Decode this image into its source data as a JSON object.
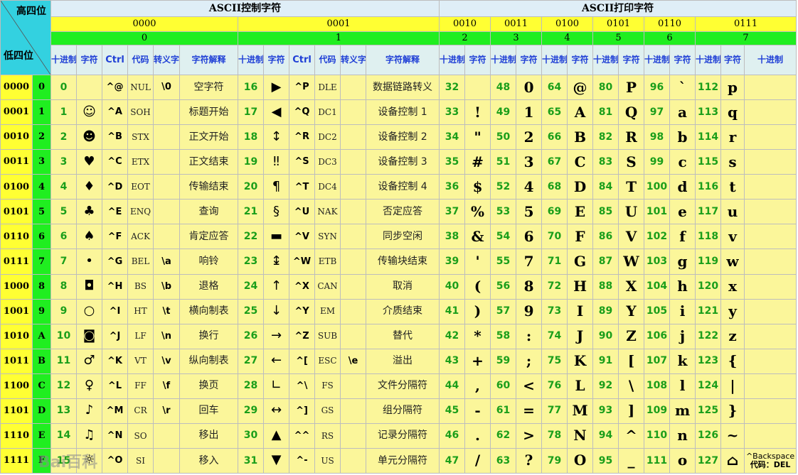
{
  "corner": {
    "high_label": "高四位",
    "low_label": "低四位"
  },
  "sections": {
    "control_title": "ASCII控制字符",
    "printable_title": "ASCII打印字符"
  },
  "high_groups": [
    {
      "bin": "0000",
      "hex": "0"
    },
    {
      "bin": "0001",
      "hex": "1"
    },
    {
      "bin": "0010",
      "hex": "2"
    },
    {
      "bin": "0011",
      "hex": "3"
    },
    {
      "bin": "0100",
      "hex": "4"
    },
    {
      "bin": "0101",
      "hex": "5"
    },
    {
      "bin": "0110",
      "hex": "6"
    },
    {
      "bin": "0111",
      "hex": "7"
    }
  ],
  "headers": {
    "decimal": "十进制",
    "char": "字符",
    "ctrl": "Ctrl",
    "code": "代码",
    "escape": "转义字符",
    "description": "字符解释"
  },
  "rows": [
    {
      "bin": "0000",
      "hex": "0",
      "g0": {
        "dec": "0",
        "char": "",
        "ctrl": "^@",
        "code": "NUL",
        "esc": "\\0",
        "desc": "空字符"
      },
      "g1": {
        "dec": "16",
        "char": "▶",
        "ctrl": "^P",
        "code": "DLE",
        "esc": "",
        "desc": "数据链路转义"
      },
      "p": [
        {
          "dec": "32",
          "char": ""
        },
        {
          "dec": "48",
          "char": "0"
        },
        {
          "dec": "64",
          "char": "@"
        },
        {
          "dec": "80",
          "char": "P"
        },
        {
          "dec": "96",
          "char": "`"
        },
        {
          "dec": "112",
          "char": "p"
        }
      ]
    },
    {
      "bin": "0001",
      "hex": "1",
      "g0": {
        "dec": "1",
        "char": "☺",
        "ctrl": "^A",
        "code": "SOH",
        "esc": "",
        "desc": "标题开始"
      },
      "g1": {
        "dec": "17",
        "char": "◀",
        "ctrl": "^Q",
        "code": "DC1",
        "esc": "",
        "desc": "设备控制 1"
      },
      "p": [
        {
          "dec": "33",
          "char": "!"
        },
        {
          "dec": "49",
          "char": "1"
        },
        {
          "dec": "65",
          "char": "A"
        },
        {
          "dec": "81",
          "char": "Q"
        },
        {
          "dec": "97",
          "char": "a"
        },
        {
          "dec": "113",
          "char": "q"
        }
      ]
    },
    {
      "bin": "0010",
      "hex": "2",
      "g0": {
        "dec": "2",
        "char": "☻",
        "ctrl": "^B",
        "code": "STX",
        "esc": "",
        "desc": "正文开始"
      },
      "g1": {
        "dec": "18",
        "char": "↕",
        "ctrl": "^R",
        "code": "DC2",
        "esc": "",
        "desc": "设备控制 2"
      },
      "p": [
        {
          "dec": "34",
          "char": "\""
        },
        {
          "dec": "50",
          "char": "2"
        },
        {
          "dec": "66",
          "char": "B"
        },
        {
          "dec": "82",
          "char": "R"
        },
        {
          "dec": "98",
          "char": "b"
        },
        {
          "dec": "114",
          "char": "r"
        }
      ]
    },
    {
      "bin": "0011",
      "hex": "3",
      "g0": {
        "dec": "3",
        "char": "♥",
        "ctrl": "^C",
        "code": "ETX",
        "esc": "",
        "desc": "正文结束"
      },
      "g1": {
        "dec": "19",
        "char": "‼",
        "ctrl": "^S",
        "code": "DC3",
        "esc": "",
        "desc": "设备控制 3"
      },
      "p": [
        {
          "dec": "35",
          "char": "#"
        },
        {
          "dec": "51",
          "char": "3"
        },
        {
          "dec": "67",
          "char": "C"
        },
        {
          "dec": "83",
          "char": "S"
        },
        {
          "dec": "99",
          "char": "c"
        },
        {
          "dec": "115",
          "char": "s"
        }
      ]
    },
    {
      "bin": "0100",
      "hex": "4",
      "g0": {
        "dec": "4",
        "char": "♦",
        "ctrl": "^D",
        "code": "EOT",
        "esc": "",
        "desc": "传输结束"
      },
      "g1": {
        "dec": "20",
        "char": "¶",
        "ctrl": "^T",
        "code": "DC4",
        "esc": "",
        "desc": "设备控制 4"
      },
      "p": [
        {
          "dec": "36",
          "char": "$"
        },
        {
          "dec": "52",
          "char": "4"
        },
        {
          "dec": "68",
          "char": "D"
        },
        {
          "dec": "84",
          "char": "T"
        },
        {
          "dec": "100",
          "char": "d"
        },
        {
          "dec": "116",
          "char": "t"
        }
      ]
    },
    {
      "bin": "0101",
      "hex": "5",
      "g0": {
        "dec": "5",
        "char": "♣",
        "ctrl": "^E",
        "code": "ENQ",
        "esc": "",
        "desc": "查询"
      },
      "g1": {
        "dec": "21",
        "char": "§",
        "ctrl": "^U",
        "code": "NAK",
        "esc": "",
        "desc": "否定应答"
      },
      "p": [
        {
          "dec": "37",
          "char": "%"
        },
        {
          "dec": "53",
          "char": "5"
        },
        {
          "dec": "69",
          "char": "E"
        },
        {
          "dec": "85",
          "char": "U"
        },
        {
          "dec": "101",
          "char": "e"
        },
        {
          "dec": "117",
          "char": "u"
        }
      ]
    },
    {
      "bin": "0110",
      "hex": "6",
      "g0": {
        "dec": "6",
        "char": "♠",
        "ctrl": "^F",
        "code": "ACK",
        "esc": "",
        "desc": "肯定应答"
      },
      "g1": {
        "dec": "22",
        "char": "▬",
        "ctrl": "^V",
        "code": "SYN",
        "esc": "",
        "desc": "同步空闲"
      },
      "p": [
        {
          "dec": "38",
          "char": "&"
        },
        {
          "dec": "54",
          "char": "6"
        },
        {
          "dec": "70",
          "char": "F"
        },
        {
          "dec": "86",
          "char": "V"
        },
        {
          "dec": "102",
          "char": "f"
        },
        {
          "dec": "118",
          "char": "v"
        }
      ]
    },
    {
      "bin": "0111",
      "hex": "7",
      "g0": {
        "dec": "7",
        "char": "•",
        "ctrl": "^G",
        "code": "BEL",
        "esc": "\\a",
        "desc": "响铃"
      },
      "g1": {
        "dec": "23",
        "char": "↨",
        "ctrl": "^W",
        "code": "ETB",
        "esc": "",
        "desc": "传输块结束"
      },
      "p": [
        {
          "dec": "39",
          "char": "'"
        },
        {
          "dec": "55",
          "char": "7"
        },
        {
          "dec": "71",
          "char": "G"
        },
        {
          "dec": "87",
          "char": "W"
        },
        {
          "dec": "103",
          "char": "g"
        },
        {
          "dec": "119",
          "char": "w"
        }
      ]
    },
    {
      "bin": "1000",
      "hex": "8",
      "g0": {
        "dec": "8",
        "char": "◘",
        "ctrl": "^H",
        "code": "BS",
        "esc": "\\b",
        "desc": "退格"
      },
      "g1": {
        "dec": "24",
        "char": "↑",
        "ctrl": "^X",
        "code": "CAN",
        "esc": "",
        "desc": "取消"
      },
      "p": [
        {
          "dec": "40",
          "char": "("
        },
        {
          "dec": "56",
          "char": "8"
        },
        {
          "dec": "72",
          "char": "H"
        },
        {
          "dec": "88",
          "char": "X"
        },
        {
          "dec": "104",
          "char": "h"
        },
        {
          "dec": "120",
          "char": "x"
        }
      ]
    },
    {
      "bin": "1001",
      "hex": "9",
      "g0": {
        "dec": "9",
        "char": "○",
        "ctrl": "^I",
        "code": "HT",
        "esc": "\\t",
        "desc": "横向制表"
      },
      "g1": {
        "dec": "25",
        "char": "↓",
        "ctrl": "^Y",
        "code": "EM",
        "esc": "",
        "desc": "介质结束"
      },
      "p": [
        {
          "dec": "41",
          "char": ")"
        },
        {
          "dec": "57",
          "char": "9"
        },
        {
          "dec": "73",
          "char": "I"
        },
        {
          "dec": "89",
          "char": "Y"
        },
        {
          "dec": "105",
          "char": "i"
        },
        {
          "dec": "121",
          "char": "y"
        }
      ]
    },
    {
      "bin": "1010",
      "hex": "A",
      "g0": {
        "dec": "10",
        "char": "◙",
        "ctrl": "^J",
        "code": "LF",
        "esc": "\\n",
        "desc": "换行"
      },
      "g1": {
        "dec": "26",
        "char": "→",
        "ctrl": "^Z",
        "code": "SUB",
        "esc": "",
        "desc": "替代"
      },
      "p": [
        {
          "dec": "42",
          "char": "*"
        },
        {
          "dec": "58",
          "char": ":"
        },
        {
          "dec": "74",
          "char": "J"
        },
        {
          "dec": "90",
          "char": "Z"
        },
        {
          "dec": "106",
          "char": "j"
        },
        {
          "dec": "122",
          "char": "z"
        }
      ]
    },
    {
      "bin": "1011",
      "hex": "B",
      "g0": {
        "dec": "11",
        "char": "♂",
        "ctrl": "^K",
        "code": "VT",
        "esc": "\\v",
        "desc": "纵向制表"
      },
      "g1": {
        "dec": "27",
        "char": "←",
        "ctrl": "^[",
        "code": "ESC",
        "esc": "\\e",
        "desc": "溢出"
      },
      "p": [
        {
          "dec": "43",
          "char": "+"
        },
        {
          "dec": "59",
          "char": ";"
        },
        {
          "dec": "75",
          "char": "K"
        },
        {
          "dec": "91",
          "char": "["
        },
        {
          "dec": "107",
          "char": "k"
        },
        {
          "dec": "123",
          "char": "{"
        }
      ]
    },
    {
      "bin": "1100",
      "hex": "C",
      "g0": {
        "dec": "12",
        "char": "♀",
        "ctrl": "^L",
        "code": "FF",
        "esc": "\\f",
        "desc": "换页"
      },
      "g1": {
        "dec": "28",
        "char": "∟",
        "ctrl": "^\\",
        "code": "FS",
        "esc": "",
        "desc": "文件分隔符"
      },
      "p": [
        {
          "dec": "44",
          "char": ","
        },
        {
          "dec": "60",
          "char": "<"
        },
        {
          "dec": "76",
          "char": "L"
        },
        {
          "dec": "92",
          "char": "\\"
        },
        {
          "dec": "108",
          "char": "l"
        },
        {
          "dec": "124",
          "char": "|"
        }
      ]
    },
    {
      "bin": "1101",
      "hex": "D",
      "g0": {
        "dec": "13",
        "char": "♪",
        "ctrl": "^M",
        "code": "CR",
        "esc": "\\r",
        "desc": "回车"
      },
      "g1": {
        "dec": "29",
        "char": "↔",
        "ctrl": "^]",
        "code": "GS",
        "esc": "",
        "desc": "组分隔符"
      },
      "p": [
        {
          "dec": "45",
          "char": "-"
        },
        {
          "dec": "61",
          "char": "="
        },
        {
          "dec": "77",
          "char": "M"
        },
        {
          "dec": "93",
          "char": "]"
        },
        {
          "dec": "109",
          "char": "m"
        },
        {
          "dec": "125",
          "char": "}"
        }
      ]
    },
    {
      "bin": "1110",
      "hex": "E",
      "g0": {
        "dec": "14",
        "char": "♫",
        "ctrl": "^N",
        "code": "SO",
        "esc": "",
        "desc": "移出"
      },
      "g1": {
        "dec": "30",
        "char": "▲",
        "ctrl": "^^",
        "code": "RS",
        "esc": "",
        "desc": "记录分隔符"
      },
      "p": [
        {
          "dec": "46",
          "char": "."
        },
        {
          "dec": "62",
          "char": ">"
        },
        {
          "dec": "78",
          "char": "N"
        },
        {
          "dec": "94",
          "char": "^"
        },
        {
          "dec": "110",
          "char": "n"
        },
        {
          "dec": "126",
          "char": "~"
        }
      ]
    },
    {
      "bin": "1111",
      "hex": "F",
      "g0": {
        "dec": "15",
        "char": "☼",
        "ctrl": "^O",
        "code": "SI",
        "esc": "",
        "desc": "移入"
      },
      "g1": {
        "dec": "31",
        "char": "▼",
        "ctrl": "^-",
        "code": "US",
        "esc": "",
        "desc": "单元分隔符"
      },
      "p": [
        {
          "dec": "47",
          "char": "/"
        },
        {
          "dec": "63",
          "char": "?"
        },
        {
          "dec": "79",
          "char": "O"
        },
        {
          "dec": "95",
          "char": "_"
        },
        {
          "dec": "111",
          "char": "o"
        },
        {
          "dec": "127",
          "char": "⌂"
        }
      ]
    }
  ],
  "del_note": {
    "line1": "^Backspace",
    "line2": "代码：DEL"
  },
  "watermark": "Bai百科"
}
